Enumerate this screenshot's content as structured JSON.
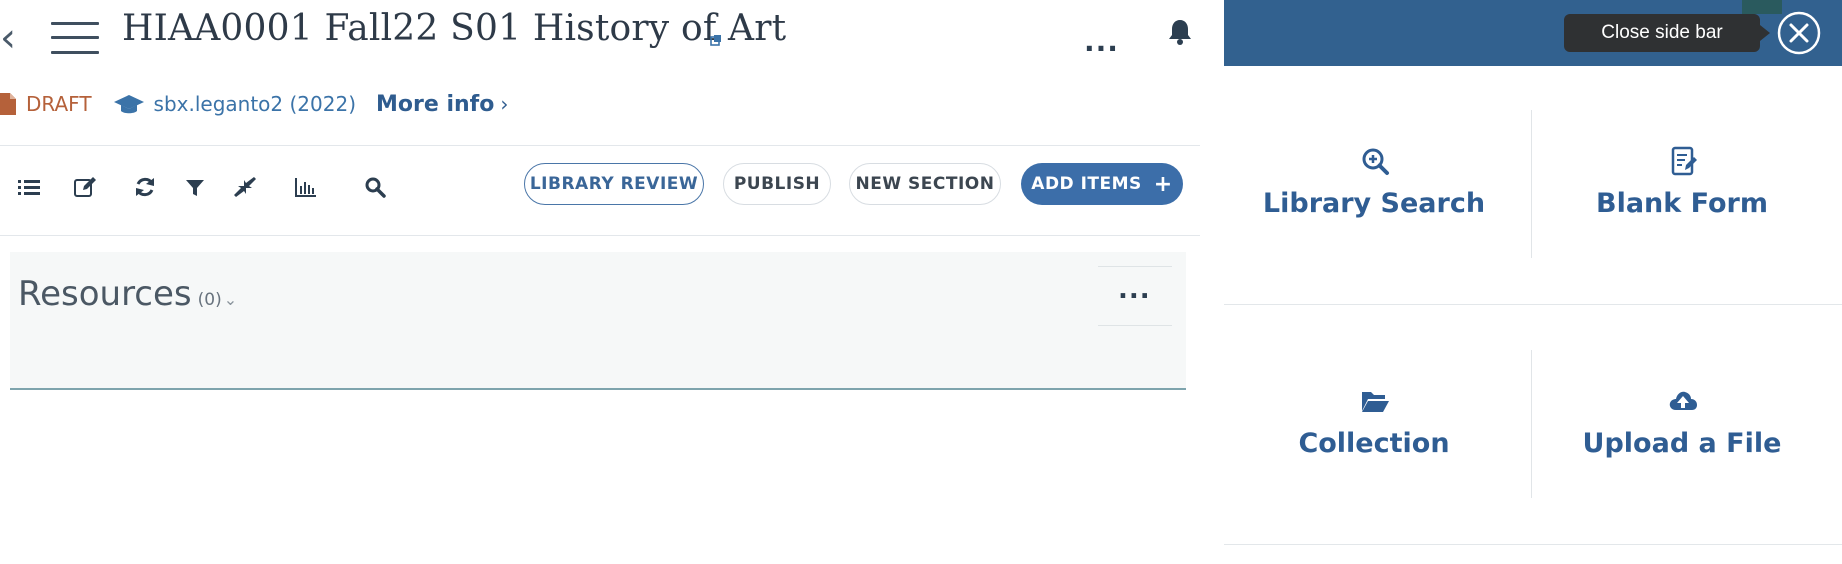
{
  "header": {
    "course_title": "HIAA0001 Fall22 S01 History of Art",
    "more_label": "...",
    "status": "DRAFT",
    "course_code": "sbx.leganto2 (2022)",
    "more_info": "More info",
    "more_info_chevron": "›"
  },
  "toolbar": {
    "library_review": "LIBRARY REVIEW",
    "publish": "PUBLISH",
    "new_section": "NEW SECTION",
    "add_items": "ADD ITEMS",
    "add_items_plus": "+"
  },
  "section": {
    "title": "Resources",
    "count": "(0)",
    "chevron": "⌄",
    "more_label": "..."
  },
  "sidebar": {
    "tooltip": "Close side bar",
    "items": [
      {
        "label": "Library Search",
        "icon": "search-plus-icon"
      },
      {
        "label": "Blank Form",
        "icon": "form-edit-icon"
      },
      {
        "label": "Collection",
        "icon": "folder-open-icon"
      },
      {
        "label": "Upload a File",
        "icon": "cloud-upload-icon"
      }
    ]
  },
  "colors": {
    "sidebar_header": "#32618f",
    "primary_button": "#3c6ea9",
    "draft": "#b5613a",
    "link": "#2f5d93"
  }
}
